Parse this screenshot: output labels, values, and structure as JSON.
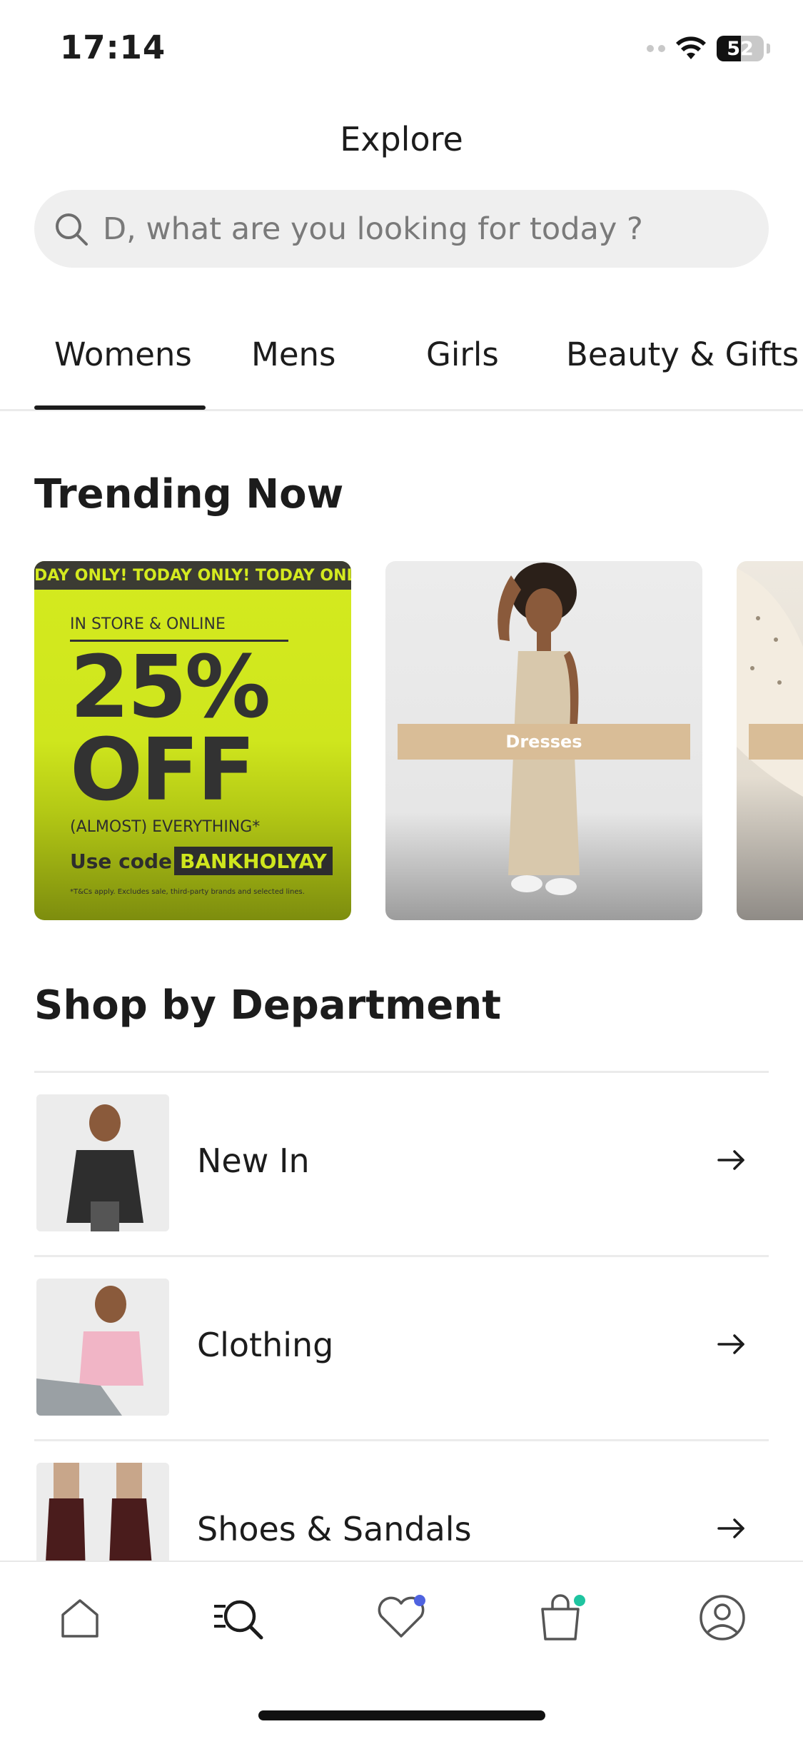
{
  "status_bar": {
    "time": "17:14",
    "battery": "52"
  },
  "header": {
    "title": "Explore",
    "search_placeholder": "D, what are you looking for today ?"
  },
  "tabs": [
    {
      "label": "Womens",
      "active": true
    },
    {
      "label": "Mens",
      "active": false
    },
    {
      "label": "Girls",
      "active": false
    },
    {
      "label": "Beauty & Gifts",
      "active": false
    }
  ],
  "trending": {
    "title": "Trending Now",
    "promo": {
      "strip": "DAY ONLY!   TODAY ONLY!   TODAY ONLY!",
      "kicker": "IN STORE & ONLINE",
      "discount": "25%",
      "off": "OFF",
      "subline": "(ALMOST) EVERYTHING*",
      "code_label": "Use code:",
      "code": "BANKHOLYAY",
      "fine_print": "*T&Cs apply. Excludes sale, third-party brands and selected lines."
    },
    "cards": [
      {
        "label": "Dresses"
      }
    ]
  },
  "departments": {
    "title": "Shop by Department",
    "items": [
      {
        "label": "New In"
      },
      {
        "label": "Clothing"
      },
      {
        "label": "Shoes & Sandals"
      }
    ]
  },
  "bottom_nav": {
    "items": [
      "home-icon",
      "explore-search-icon",
      "wishlist-heart-icon",
      "shopping-bag-icon",
      "account-icon"
    ],
    "badge_colors": {
      "wishlist": "#4f63e0",
      "bag": "#1fc4a0"
    }
  }
}
